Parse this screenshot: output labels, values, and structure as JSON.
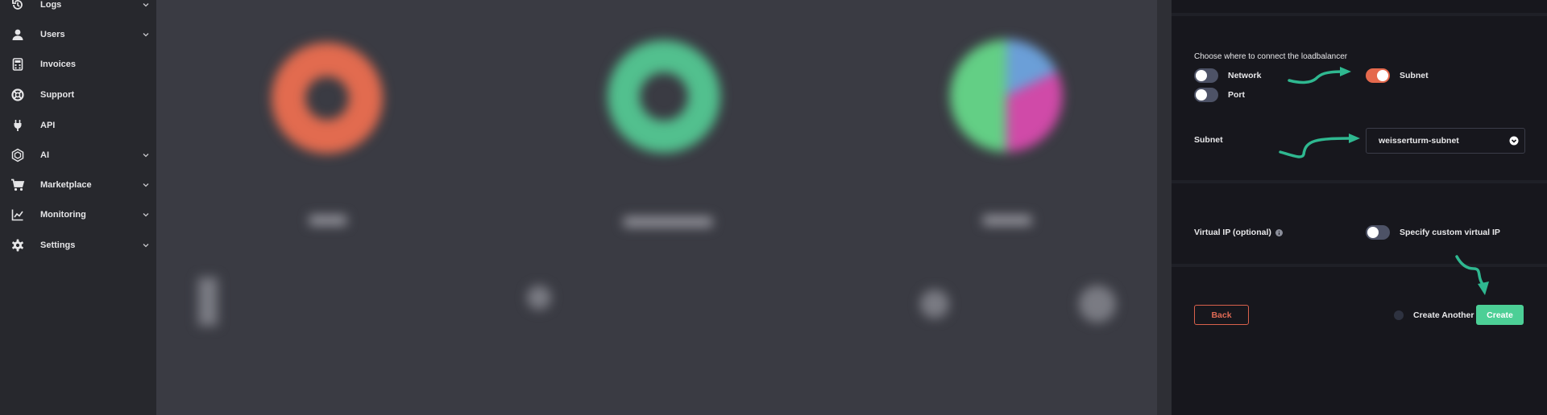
{
  "sidebar": {
    "items": [
      {
        "label": "Logs",
        "icon": "history-icon",
        "has_chevron": true
      },
      {
        "label": "Users",
        "icon": "user-icon",
        "has_chevron": true
      },
      {
        "label": "Invoices",
        "icon": "calculator-icon",
        "has_chevron": false
      },
      {
        "label": "Support",
        "icon": "lifebuoy-icon",
        "has_chevron": false
      },
      {
        "label": "API",
        "icon": "plug-icon",
        "has_chevron": false
      },
      {
        "label": "AI",
        "icon": "ai-chip-icon",
        "has_chevron": true
      },
      {
        "label": "Marketplace",
        "icon": "cart-icon",
        "has_chevron": true
      },
      {
        "label": "Monitoring",
        "icon": "chart-line-icon",
        "has_chevron": true
      },
      {
        "label": "Settings",
        "icon": "gear-icon",
        "has_chevron": true
      }
    ]
  },
  "panel": {
    "connect_heading": "Choose where to connect the loadbalancer",
    "options": {
      "network": {
        "label": "Network",
        "on": false
      },
      "subnet": {
        "label": "Subnet",
        "on": true
      },
      "port": {
        "label": "Port",
        "on": false
      }
    },
    "subnet_field": {
      "label": "Subnet",
      "value": "weisserturm-subnet"
    },
    "virtual_ip": {
      "label": "Virtual IP (optional)",
      "toggle_label": "Specify custom virtual IP",
      "on": false
    },
    "actions": {
      "back": "Back",
      "create_another": "Create Another",
      "create": "Create"
    }
  },
  "colors": {
    "accent_green": "#4ccf96",
    "accent_orange": "#e5694d",
    "annotation_arrow": "#2fb890",
    "panel_bg": "#17171d",
    "sidebar_bg": "#27282d"
  }
}
